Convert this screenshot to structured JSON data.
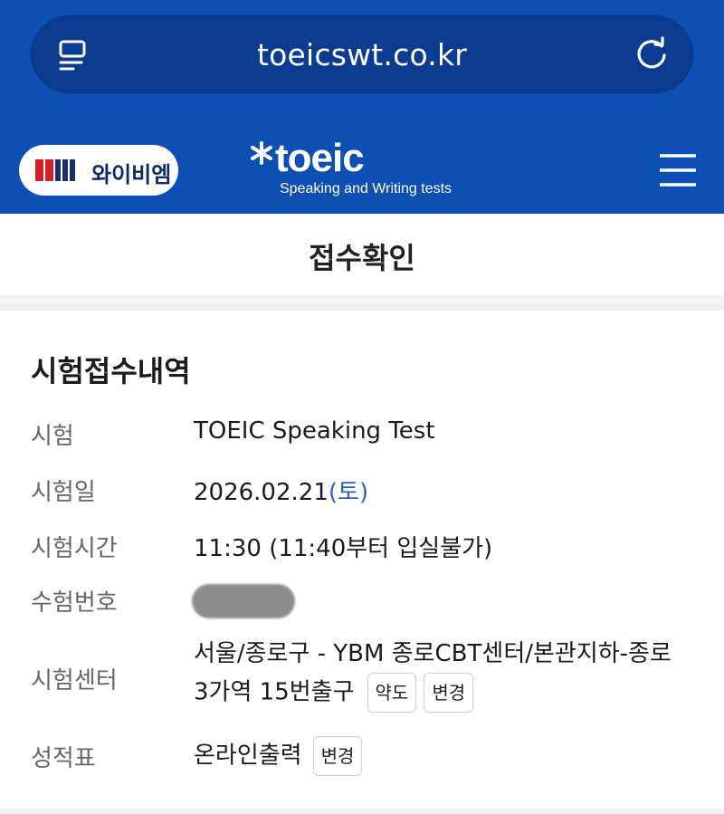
{
  "browser": {
    "url": "toeicswt.co.kr",
    "left_icon": "page-list-icon",
    "reload_icon": "reload-icon"
  },
  "header": {
    "ybm_logo_text": "와이비엠",
    "toeic_logo_word": "toeic",
    "toeic_logo_sub": "Speaking and Writing tests",
    "menu_icon": "hamburger-menu-icon"
  },
  "page": {
    "title": "접수확인"
  },
  "registration": {
    "section_title": "시험접수내역",
    "rows": {
      "exam": {
        "label": "시험",
        "value": "TOEIC Speaking Test"
      },
      "date": {
        "label": "시험일",
        "value": "2026.02.21",
        "weekday": "(토)"
      },
      "time": {
        "label": "시험시간",
        "value": "11:30 (11:40부터 입실불가)"
      },
      "number": {
        "label": "수험번호"
      },
      "center": {
        "label": "시험센터",
        "value_line1": "서울/종로구 - YBM 종로CBT센터/본관지하-종로",
        "value_line2": "3가역 15번출구",
        "map_button": "약도",
        "change_button": "변경"
      },
      "score": {
        "label": "성적표",
        "value": "온라인출력",
        "change_button": "변경"
      }
    }
  },
  "colors": {
    "header_blue": "#0e4fb4",
    "url_bar": "#0b3c8f",
    "weekday_blue": "#2a60c8"
  }
}
